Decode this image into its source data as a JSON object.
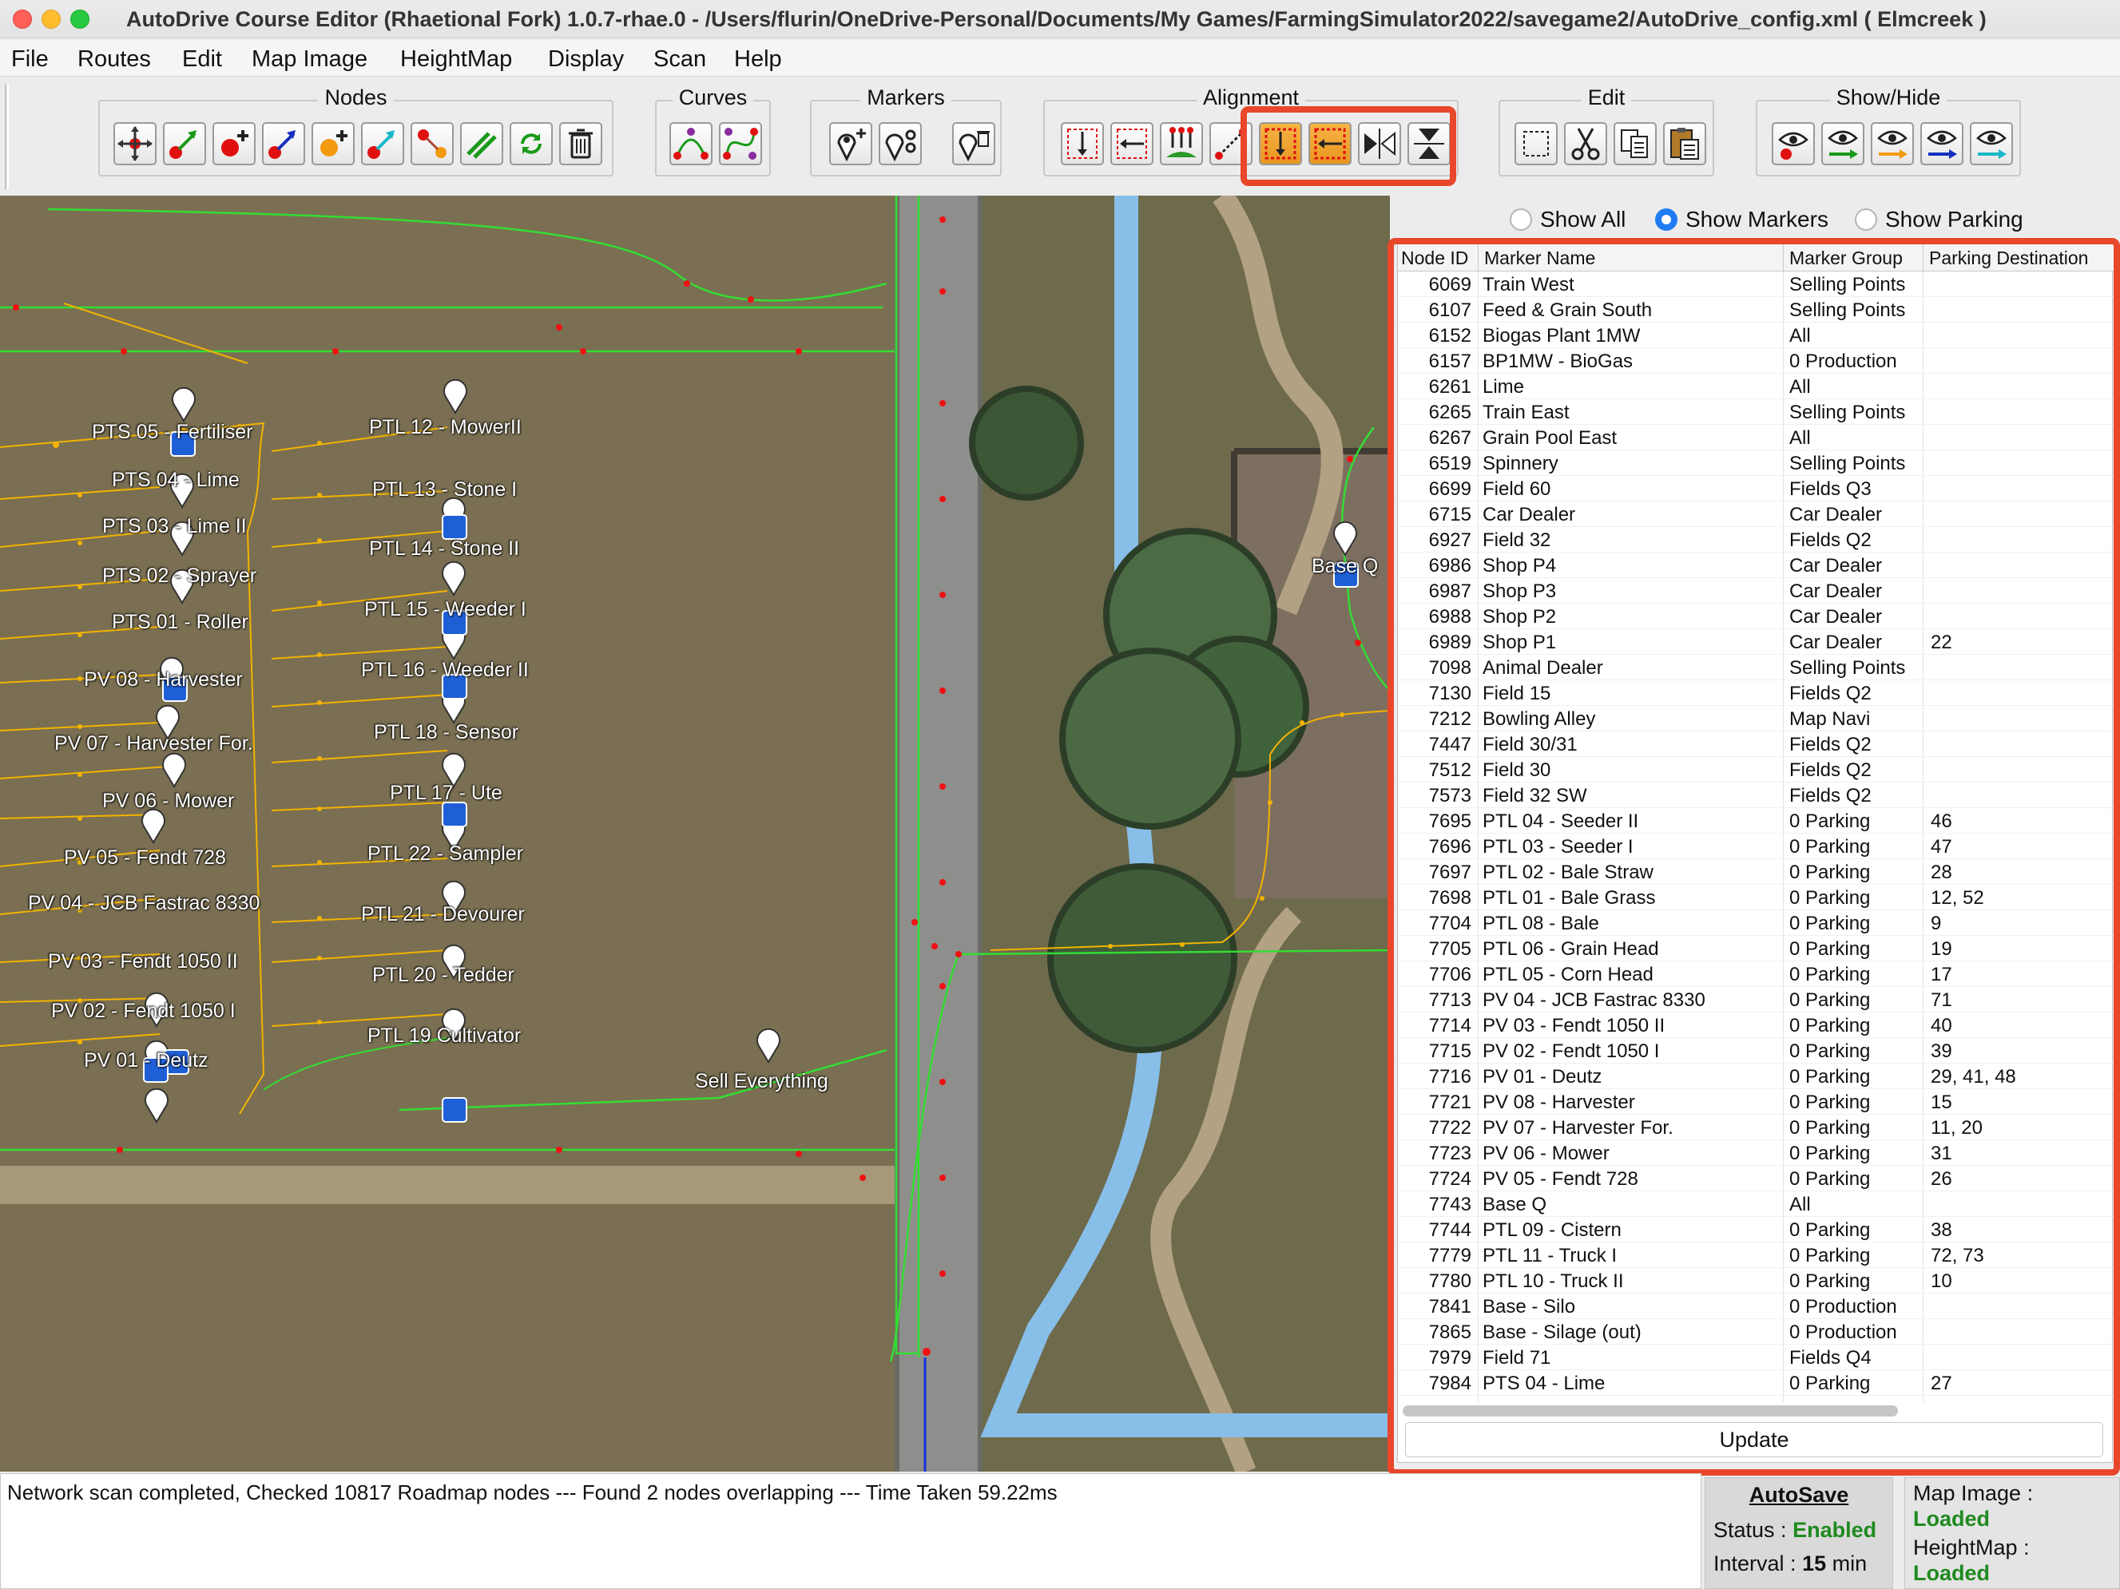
{
  "window": {
    "title": "AutoDrive Course Editor (Rhaetional Fork) 1.0.7-rhae.0 - /Users/flurin/OneDrive-Personal/Documents/My Games/FarmingSimulator2022/savegame2/AutoDrive_config.xml ( Elmcreek )"
  },
  "menu": [
    "File",
    "Routes",
    "Edit",
    "Map Image",
    "HeightMap",
    "Display",
    "Scan",
    "Help"
  ],
  "toolbar": {
    "groups": {
      "nodes": "Nodes",
      "curves": "Curves",
      "markers": "Markers",
      "alignment": "Alignment",
      "edit": "Edit",
      "show_hide": "Show/Hide"
    },
    "highlight_color": "#e8472b"
  },
  "map": {
    "labels": [
      {
        "id": "pts05",
        "text": "PTS 05 - Fertiliser"
      },
      {
        "id": "pts04",
        "text": "PTS 04 - Lime"
      },
      {
        "id": "pts03",
        "text": "PTS 03 - Lime II"
      },
      {
        "id": "pts02",
        "text": "PTS 02 - Sprayer"
      },
      {
        "id": "pts01",
        "text": "PTS 01 - Roller"
      },
      {
        "id": "pv08",
        "text": "PV 08 - Harvester"
      },
      {
        "id": "pv07",
        "text": "PV 07 - Harvester For."
      },
      {
        "id": "pv06",
        "text": "PV 06 - Mower"
      },
      {
        "id": "pv05",
        "text": "PV 05 - Fendt 728"
      },
      {
        "id": "pv04",
        "text": "PV 04 - JCB Fastrac 8330"
      },
      {
        "id": "pv03",
        "text": "PV 03 - Fendt 1050 II"
      },
      {
        "id": "pv02",
        "text": "PV 02 - Fendt 1050 I"
      },
      {
        "id": "pv01",
        "text": "PV 01 - Deutz"
      },
      {
        "id": "ptl12",
        "text": "PTL 12 - MowerII"
      },
      {
        "id": "ptl13",
        "text": "PTL 13 - Stone I"
      },
      {
        "id": "ptl14",
        "text": "PTL 14 - Stone II"
      },
      {
        "id": "ptl15",
        "text": "PTL 15 - Weeder I"
      },
      {
        "id": "ptl16",
        "text": "PTL 16 - Weeder II"
      },
      {
        "id": "ptl18",
        "text": "PTL 18 - Sensor"
      },
      {
        "id": "ptl17",
        "text": "PTL 17 - Ute"
      },
      {
        "id": "ptl22",
        "text": "PTL 22 - Sampler"
      },
      {
        "id": "ptl21",
        "text": "PTL 21 - Devourer"
      },
      {
        "id": "ptl20",
        "text": "PTL 20 - Tedder"
      },
      {
        "id": "ptl19",
        "text": "PTL 19 Cultivator"
      },
      {
        "id": "sell",
        "text": "Sell Everything"
      },
      {
        "id": "baseq",
        "text": "Base Q"
      }
    ]
  },
  "panel": {
    "filters": [
      {
        "label": "Show All",
        "selected": false
      },
      {
        "label": "Show Markers",
        "selected": true
      },
      {
        "label": "Show Parking",
        "selected": false
      }
    ],
    "columns": [
      "Node ID",
      "Marker Name",
      "Marker Group",
      "Parking Destination"
    ],
    "rows": [
      [
        "6069",
        "Train West",
        "Selling Points",
        ""
      ],
      [
        "6107",
        "Feed & Grain South",
        "Selling Points",
        ""
      ],
      [
        "6152",
        "Biogas Plant 1MW",
        "All",
        ""
      ],
      [
        "6157",
        "BP1MW - BioGas",
        "0 Production",
        ""
      ],
      [
        "6261",
        "Lime",
        "All",
        ""
      ],
      [
        "6265",
        "Train East",
        "Selling Points",
        ""
      ],
      [
        "6267",
        "Grain Pool East",
        "All",
        ""
      ],
      [
        "6519",
        "Spinnery",
        "Selling Points",
        ""
      ],
      [
        "6699",
        "Field 60",
        "Fields Q3",
        ""
      ],
      [
        "6715",
        "Car Dealer",
        "Car Dealer",
        ""
      ],
      [
        "6927",
        "Field 32",
        "Fields Q2",
        ""
      ],
      [
        "6986",
        "Shop P4",
        "Car Dealer",
        ""
      ],
      [
        "6987",
        "Shop P3",
        "Car Dealer",
        ""
      ],
      [
        "6988",
        "Shop P2",
        "Car Dealer",
        ""
      ],
      [
        "6989",
        "Shop P1",
        "Car Dealer",
        "22"
      ],
      [
        "7098",
        "Animal Dealer",
        "Selling Points",
        ""
      ],
      [
        "7130",
        "Field 15",
        "Fields Q2",
        ""
      ],
      [
        "7212",
        "Bowling Alley",
        "Map Navi",
        ""
      ],
      [
        "7447",
        "Field 30/31",
        "Fields Q2",
        ""
      ],
      [
        "7512",
        "Field 30",
        "Fields Q2",
        ""
      ],
      [
        "7573",
        "Field 32 SW",
        "Fields Q2",
        ""
      ],
      [
        "7695",
        "PTL 04 - Seeder II",
        "0 Parking",
        "46"
      ],
      [
        "7696",
        "PTL 03 - Seeder I",
        "0 Parking",
        "47"
      ],
      [
        "7697",
        "PTL 02 - Bale Straw",
        "0 Parking",
        "28"
      ],
      [
        "7698",
        "PTL 01 - Bale Grass",
        "0 Parking",
        "12, 52"
      ],
      [
        "7704",
        "PTL 08 - Bale",
        "0 Parking",
        "9"
      ],
      [
        "7705",
        "PTL 06 - Grain Head",
        "0 Parking",
        "19"
      ],
      [
        "7706",
        "PTL 05 - Corn Head",
        "0 Parking",
        "17"
      ],
      [
        "7713",
        "PV 04 - JCB Fastrac 8330",
        "0 Parking",
        "71"
      ],
      [
        "7714",
        "PV 03 - Fendt 1050 II",
        "0 Parking",
        "40"
      ],
      [
        "7715",
        "PV 02 - Fendt 1050 I",
        "0 Parking",
        "39"
      ],
      [
        "7716",
        "PV 01 - Deutz",
        "0 Parking",
        "29, 41, 48"
      ],
      [
        "7721",
        "PV 08 - Harvester",
        "0 Parking",
        "15"
      ],
      [
        "7722",
        "PV 07 - Harvester For.",
        "0 Parking",
        "11, 20"
      ],
      [
        "7723",
        "PV 06 - Mower",
        "0 Parking",
        "31"
      ],
      [
        "7724",
        "PV 05 - Fendt 728",
        "0 Parking",
        "26"
      ],
      [
        "7743",
        "Base Q",
        "All",
        ""
      ],
      [
        "7744",
        "PTL 09 - Cistern",
        "0 Parking",
        "38"
      ],
      [
        "7779",
        "PTL 11 - Truck I",
        "0 Parking",
        "72, 73"
      ],
      [
        "7780",
        "PTL 10 - Truck II",
        "0 Parking",
        "10"
      ],
      [
        "7841",
        "Base - Silo",
        "0 Production",
        ""
      ],
      [
        "7865",
        "Base - Silage (out)",
        "0 Production",
        ""
      ],
      [
        "7979",
        "Field 71",
        "Fields Q4",
        ""
      ],
      [
        "7984",
        "PTS 04 - Lime",
        "0 Parking",
        "27"
      ]
    ],
    "update_label": "Update"
  },
  "status": {
    "log": "Network scan completed, Checked 10817 Roadmap nodes --- Found 2 nodes overlapping --- Time Taken 59.22ms",
    "autosave": {
      "title": "AutoSave",
      "status_label": "Status :",
      "status_value": "Enabled",
      "interval_label": "Interval :",
      "interval_value": "15",
      "interval_unit": "min"
    },
    "map_image_label": "Map Image :",
    "map_image_value": "Loaded",
    "heightmap_label": "HeightMap :",
    "heightmap_value": "Loaded"
  }
}
